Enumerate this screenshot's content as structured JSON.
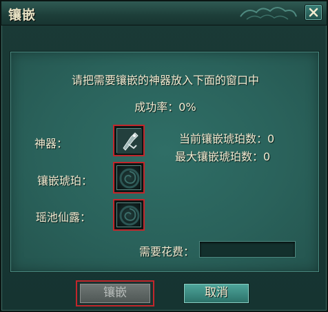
{
  "window": {
    "title": "镶嵌"
  },
  "panel": {
    "instruction": "请把需要镶嵌的神器放入下面的窗口中",
    "success_rate": "成功率：0%"
  },
  "slots": {
    "artifact_label": "神器：",
    "amber_label": "镶嵌琥珀：",
    "dew_label": "瑶池仙露："
  },
  "info": {
    "current_amber": "当前镶嵌琥珀数：0",
    "max_amber": "最大镶嵌琥珀数：0"
  },
  "cost": {
    "label": "需要花费：",
    "value": ""
  },
  "buttons": {
    "inlay": "镶嵌",
    "cancel": "取消"
  },
  "colors": {
    "highlight": "#c3262b",
    "panel": "#2a625b",
    "text": "#f3ecd2"
  }
}
